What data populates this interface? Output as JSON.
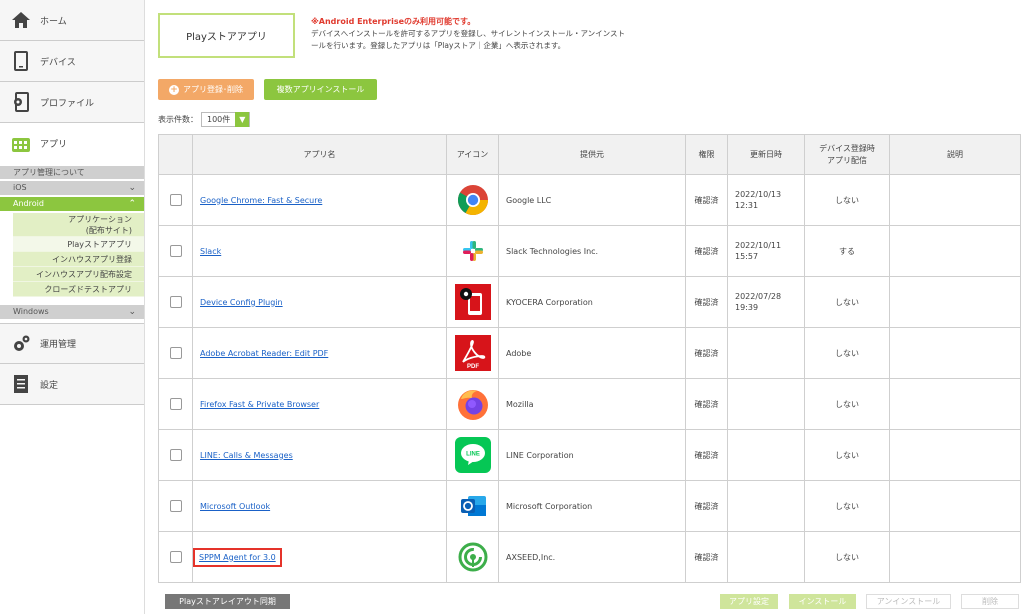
{
  "sidebar": {
    "home": "ホーム",
    "devices": "デバイス",
    "profile": "プロファイル",
    "apps": "アプリ",
    "about": "アプリ管理について",
    "ios": "iOS",
    "android": "Android",
    "android_items": [
      "アプリケーション",
      "(配布サイト)",
      "Playストアアプリ",
      "インハウスアプリ登録",
      "インハウスアプリ配布設定",
      "クローズドテストアプリ"
    ],
    "windows": "Windows",
    "operations": "運用管理",
    "settings": "設定"
  },
  "header": {
    "title": "Playストアアプリ",
    "notice_warn": "※Android Enterpriseのみ利用可能です。",
    "notice_line1": "デバイスへインストールを許可するアプリを登録し、サイレントインストール・アンインスト",
    "notice_line2": "ールを行います。登録したアプリは「Playストア｜企業」へ表示されます。"
  },
  "actions": {
    "register": "アプリ登録･削除",
    "multi_install": "複数アプリインストール",
    "count_label": "表示件数：",
    "count_value": "100件"
  },
  "table": {
    "headers": {
      "name": "アプリ名",
      "icon": "アイコン",
      "provider": "提供元",
      "permission": "権限",
      "updated": "更新日時",
      "device1": "デバイス登録時",
      "device2": "アプリ配信",
      "desc": "説明"
    },
    "rows": [
      {
        "name": "Google Chrome: Fast & Secure",
        "icon": "chrome-icon",
        "provider": "Google LLC",
        "perm": "確認済",
        "date1": "2022/10/13",
        "date2": "12:31",
        "dev": "しない"
      },
      {
        "name": "Slack",
        "icon": "slack-icon",
        "provider": "Slack Technologies Inc.",
        "perm": "確認済",
        "date1": "2022/10/11",
        "date2": "15:57",
        "dev": "する"
      },
      {
        "name": "Device Config Plugin",
        "icon": "device-config-icon",
        "provider": "KYOCERA Corporation",
        "perm": "確認済",
        "date1": "2022/07/28",
        "date2": "19:39",
        "dev": "しない"
      },
      {
        "name": "Adobe Acrobat Reader: Edit PDF",
        "icon": "adobe-acrobat-icon",
        "provider": "Adobe",
        "perm": "確認済",
        "date1": "",
        "date2": "",
        "dev": "しない"
      },
      {
        "name": "Firefox Fast & Private Browser",
        "icon": "firefox-icon",
        "provider": "Mozilla",
        "perm": "確認済",
        "date1": "",
        "date2": "",
        "dev": "しない"
      },
      {
        "name": "LINE: Calls & Messages",
        "icon": "line-icon",
        "provider": "LINE Corporation",
        "perm": "確認済",
        "date1": "",
        "date2": "",
        "dev": "しない"
      },
      {
        "name": "Microsoft Outlook",
        "icon": "outlook-icon",
        "provider": "Microsoft Corporation",
        "perm": "確認済",
        "date1": "",
        "date2": "",
        "dev": "しない"
      },
      {
        "name": "SPPM Agent for 3.0",
        "icon": "sppm-icon",
        "provider": "AXSEED,Inc.",
        "perm": "確認済",
        "date1": "",
        "date2": "",
        "dev": "しない"
      }
    ]
  },
  "footer": {
    "sync": "Playストアレイアウト同期",
    "app_settings": "アプリ設定",
    "install": "インストール",
    "uninstall": "アンインストール",
    "delete": "削除"
  },
  "colors": {
    "accent": "#8cc63f",
    "orange": "#f3a867",
    "link": "#1a61c7",
    "highlight": "#e5332a"
  }
}
